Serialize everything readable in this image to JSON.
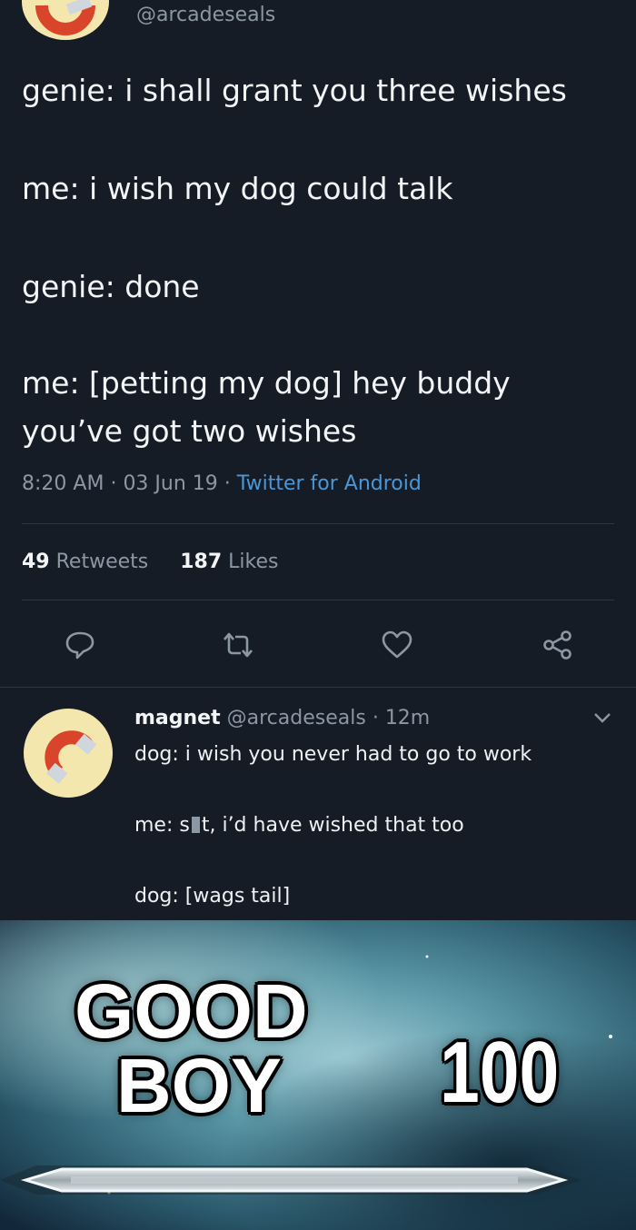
{
  "tweet": {
    "handle": "@arcadeseals",
    "lines": [
      "genie: i shall grant you three wishes",
      "me: i wish my dog could talk",
      "genie: done",
      "me: [petting my dog] hey buddy",
      "you’ve got two wishes"
    ],
    "time": "8:20 AM",
    "date": "03 Jun 19",
    "source": "Twitter for Android",
    "retweets_count": "49",
    "retweets_label": "Retweets",
    "likes_count": "187",
    "likes_label": "Likes",
    "actions": [
      "reply-icon",
      "retweet-icon",
      "heart-icon",
      "share-icon"
    ]
  },
  "reply": {
    "name": "magnet",
    "handle": "@arcadeseals",
    "age": "12m",
    "lines": [
      "dog: i wish you never had to go to work",
      "me: s",
      "t, i’d have wished that too",
      "dog: [wags tail]"
    ]
  },
  "meme": {
    "title_line1": "GOOD",
    "title_line2": "BOY",
    "level": "100"
  },
  "colors": {
    "background": "#161c25",
    "muted": "#8c97a4",
    "link": "#4a97d8",
    "avatar_bg": "#f4e7ad",
    "magnet_red": "#d8452b"
  }
}
